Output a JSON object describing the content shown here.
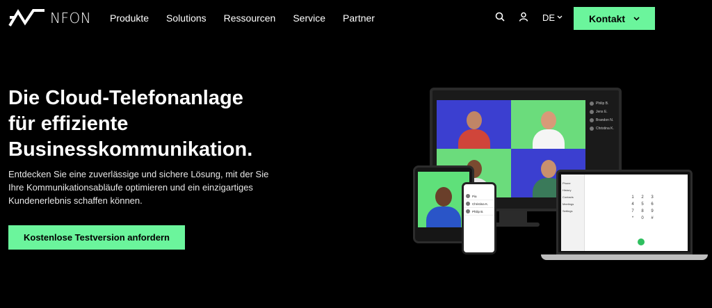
{
  "brand": {
    "name": "NFON"
  },
  "nav": {
    "menu": [
      "Produkte",
      "Solutions",
      "Ressourcen",
      "Service",
      "Partner"
    ],
    "language": "DE",
    "contact_label": "Kontakt"
  },
  "hero": {
    "headline_line1": "Die Cloud-Telefonanlage",
    "headline_line2": "für effiziente",
    "headline_line3": "Businesskommunikation.",
    "subtext": "Entdecken Sie eine zuverlässige und sichere Lösung, mit der Sie Ihre Kommunikationsabläufe optimieren und ein einzigartiges Kundenerlebnis schaffen können.",
    "cta_label": "Kostenlose Testversion anfordern"
  },
  "mockup": {
    "participants": [
      "Philip B.",
      "Jens E.",
      "Brandon N.",
      "Christina K."
    ],
    "phone_contacts": [
      "Pia",
      "Christina K.",
      "Philip B."
    ],
    "laptop_menu": [
      "Phone",
      "History",
      "Contacts",
      "Meetings",
      "Settings"
    ],
    "keypad": [
      "1",
      "2",
      "3",
      "4",
      "5",
      "6",
      "7",
      "8",
      "9",
      "*",
      "0",
      "#"
    ]
  },
  "colors": {
    "accent": "#6bf59c",
    "background": "#000000",
    "tile_blue": "#3b3fd0",
    "tile_green": "#6bdc7c"
  }
}
